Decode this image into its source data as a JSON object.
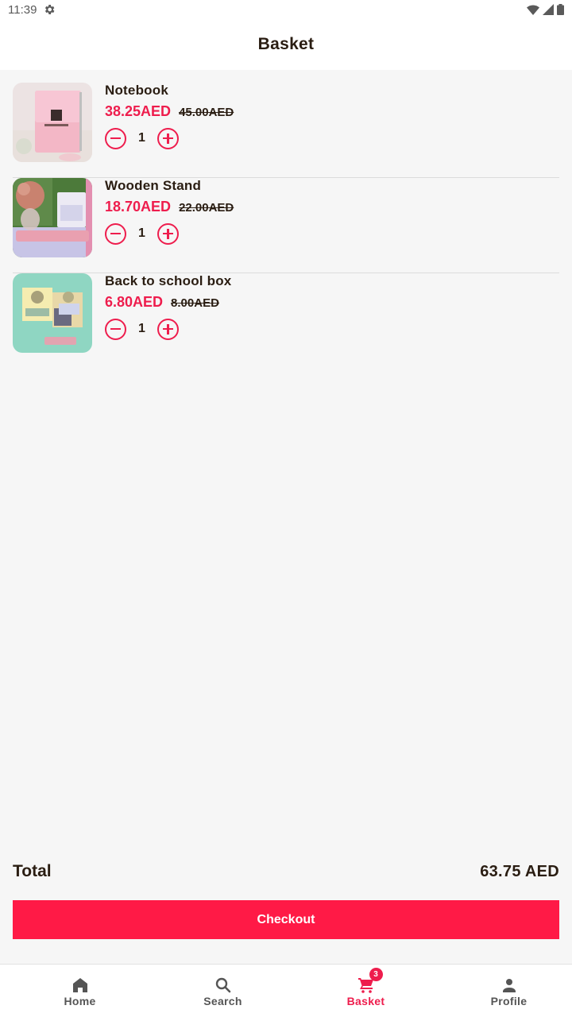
{
  "status_bar": {
    "time": "11:39"
  },
  "header": {
    "title": "Basket"
  },
  "basket": {
    "items": [
      {
        "name": "Notebook",
        "price": "38.25AED",
        "old_price": "45.00AED",
        "quantity": "1"
      },
      {
        "name": "Wooden Stand",
        "price": "18.70AED",
        "old_price": "22.00AED",
        "quantity": "1"
      },
      {
        "name": "Back to school box",
        "price": "6.80AED",
        "old_price": "8.00AED",
        "quantity": "1"
      }
    ]
  },
  "summary": {
    "total_label": "Total",
    "total_value": "63.75 AED",
    "checkout_label": "Checkout"
  },
  "bottom_nav": {
    "items": [
      {
        "label": "Home",
        "icon": "home-icon"
      },
      {
        "label": "Search",
        "icon": "search-icon"
      },
      {
        "label": "Basket",
        "icon": "cart-icon",
        "badge": "3",
        "active": true
      },
      {
        "label": "Profile",
        "icon": "person-icon"
      }
    ]
  },
  "colors": {
    "accent": "#ee1d4d",
    "button": "#ff1a46",
    "text": "#2a1d12",
    "background": "#f6f6f6"
  }
}
